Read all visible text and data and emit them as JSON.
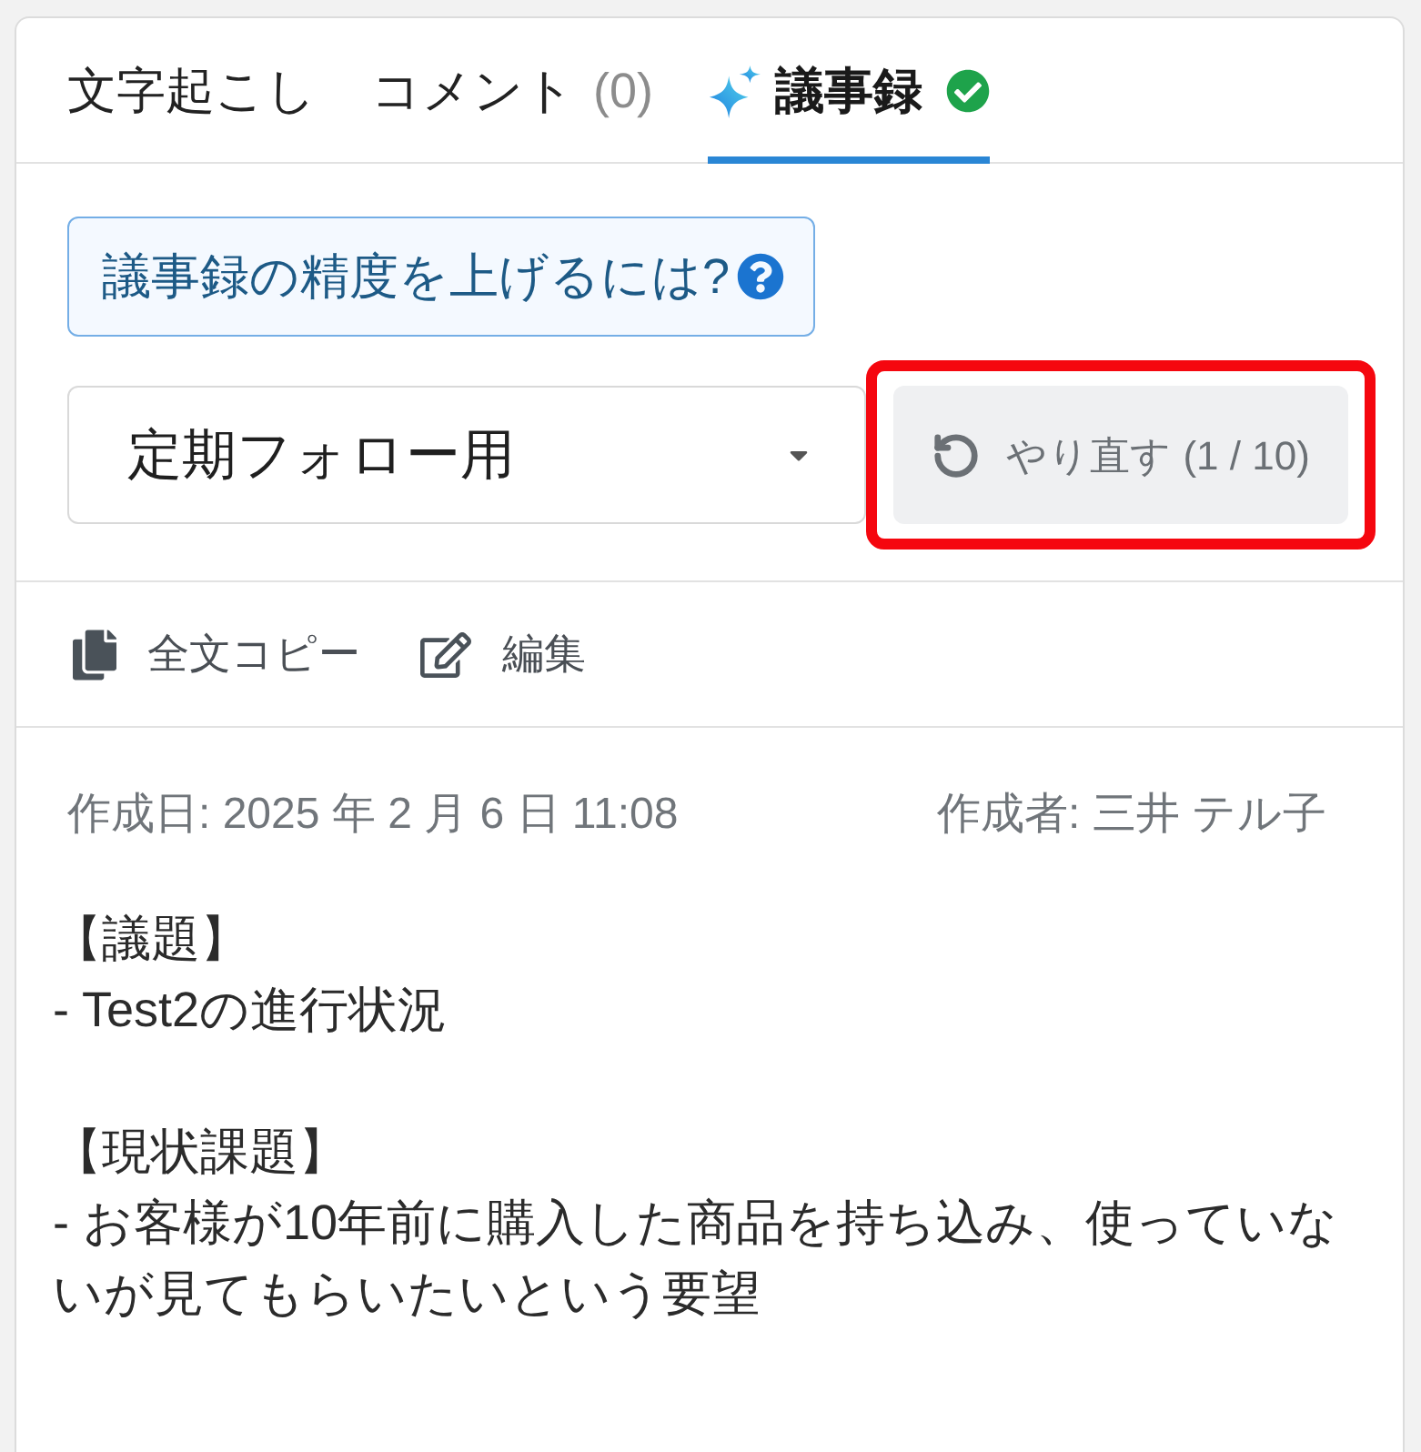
{
  "tabs": [
    {
      "label": "文字起こし",
      "kind": "text",
      "selected": false,
      "completed": false
    },
    {
      "label": "コメント",
      "count": "(0)",
      "kind": "text",
      "selected": false,
      "completed": false
    },
    {
      "label": "議事録",
      "kind": "ai",
      "selected": true,
      "completed": true
    }
  ],
  "hint_button": {
    "label": "議事録の精度を上げるには?"
  },
  "template_select": {
    "value": "定期フォロー用"
  },
  "redo_button": {
    "label": "やり直す (1 / 10)",
    "highlighted": true
  },
  "actions": [
    {
      "kind": "copy",
      "label": "全文コピー"
    },
    {
      "kind": "edit",
      "label": "編集"
    }
  ],
  "meta": {
    "created": "作成日: 2025 年 2 月 6 日 11:08",
    "author": "作成者: 三井 テル子"
  },
  "minutes": [
    {
      "heading": "【議題】",
      "items": [
        "- Test2の進行状況"
      ]
    },
    {
      "heading": "【現状課題】",
      "items": [
        "- お客様が10年前に購入した商品を持ち込み、使っていないが見てもらいたいという要望"
      ]
    }
  ]
}
